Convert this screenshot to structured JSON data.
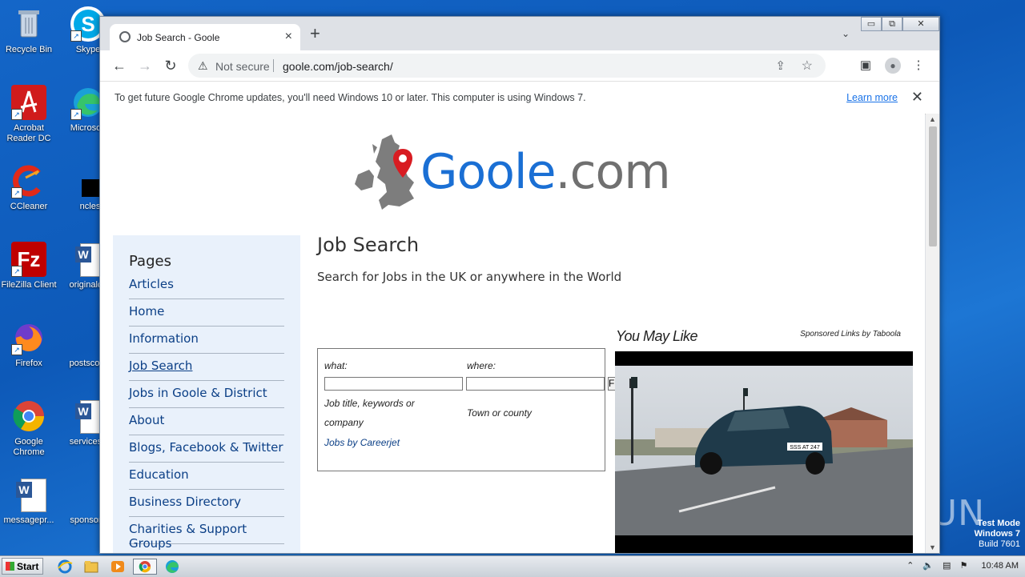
{
  "desktop": {
    "icons": [
      {
        "label": "Recycle Bin"
      },
      {
        "label": "Skype"
      },
      {
        "label": "Acrobat Reader DC"
      },
      {
        "label": "Microsoft"
      },
      {
        "label": "CCleaner"
      },
      {
        "label": "ncless.j"
      },
      {
        "label": "FileZilla Client"
      },
      {
        "label": "originalce"
      },
      {
        "label": "Firefox"
      },
      {
        "label": "postscont"
      },
      {
        "label": "Google Chrome"
      },
      {
        "label": "servicesp"
      },
      {
        "label": "messagepr..."
      },
      {
        "label": "sponsore"
      }
    ]
  },
  "browser": {
    "tab_title": "Job Search - Goole",
    "tab_close": "×",
    "new_tab": "+",
    "tab_search": "⌄",
    "window_controls": {
      "minimize": "▭",
      "restore": "⧉",
      "close": "✕"
    },
    "nav": {
      "back": "←",
      "forward": "→",
      "reload": "↻"
    },
    "security_label": "Not secure",
    "url": "goole.com/job-search/",
    "infobar": {
      "message": "To get future Google Chrome updates, you'll need Windows 10 or later. This computer is using Windows 7.",
      "link": "Learn more",
      "close": "✕"
    }
  },
  "site": {
    "logo_name": "Goole",
    "logo_tld": ".com",
    "sidebar": {
      "heading": "Pages",
      "items": [
        {
          "label": "Articles"
        },
        {
          "label": "Home"
        },
        {
          "label": "Information"
        },
        {
          "label": "Job Search"
        },
        {
          "label": "Jobs in Goole & District"
        },
        {
          "label": "About"
        },
        {
          "label": "Blogs, Facebook & Twitter"
        },
        {
          "label": "Education"
        },
        {
          "label": "Business Directory"
        },
        {
          "label": "Charities & Support Groups"
        }
      ]
    },
    "title": "Job Search",
    "subtitle": "Search for Jobs in the UK or anywhere in the World",
    "job_form": {
      "what_label": "what:",
      "where_label": "where:",
      "what_value": "",
      "where_value": "",
      "what_hint": "Job title, keywords or company",
      "where_hint": "Town or county",
      "careerjet": "Jobs by Careerjet",
      "button": "F"
    },
    "ad": {
      "heading": "You May Like",
      "sponsored": "Sponsored Links by Taboola",
      "plate": "SSS AT 247"
    }
  },
  "watermark": {
    "brand": "ANY ▷ RUN",
    "test_mode": "Test Mode",
    "os": "Windows 7",
    "build": "Build 7601"
  },
  "taskbar": {
    "start": "Start",
    "time": "10:48 AM"
  },
  "colors": {
    "desktop": "#0d59b8",
    "logo_blue": "#1a6fd4",
    "logo_grey": "#707070",
    "sidebar_bg": "#e9f1fb",
    "link": "#0b3f86"
  }
}
